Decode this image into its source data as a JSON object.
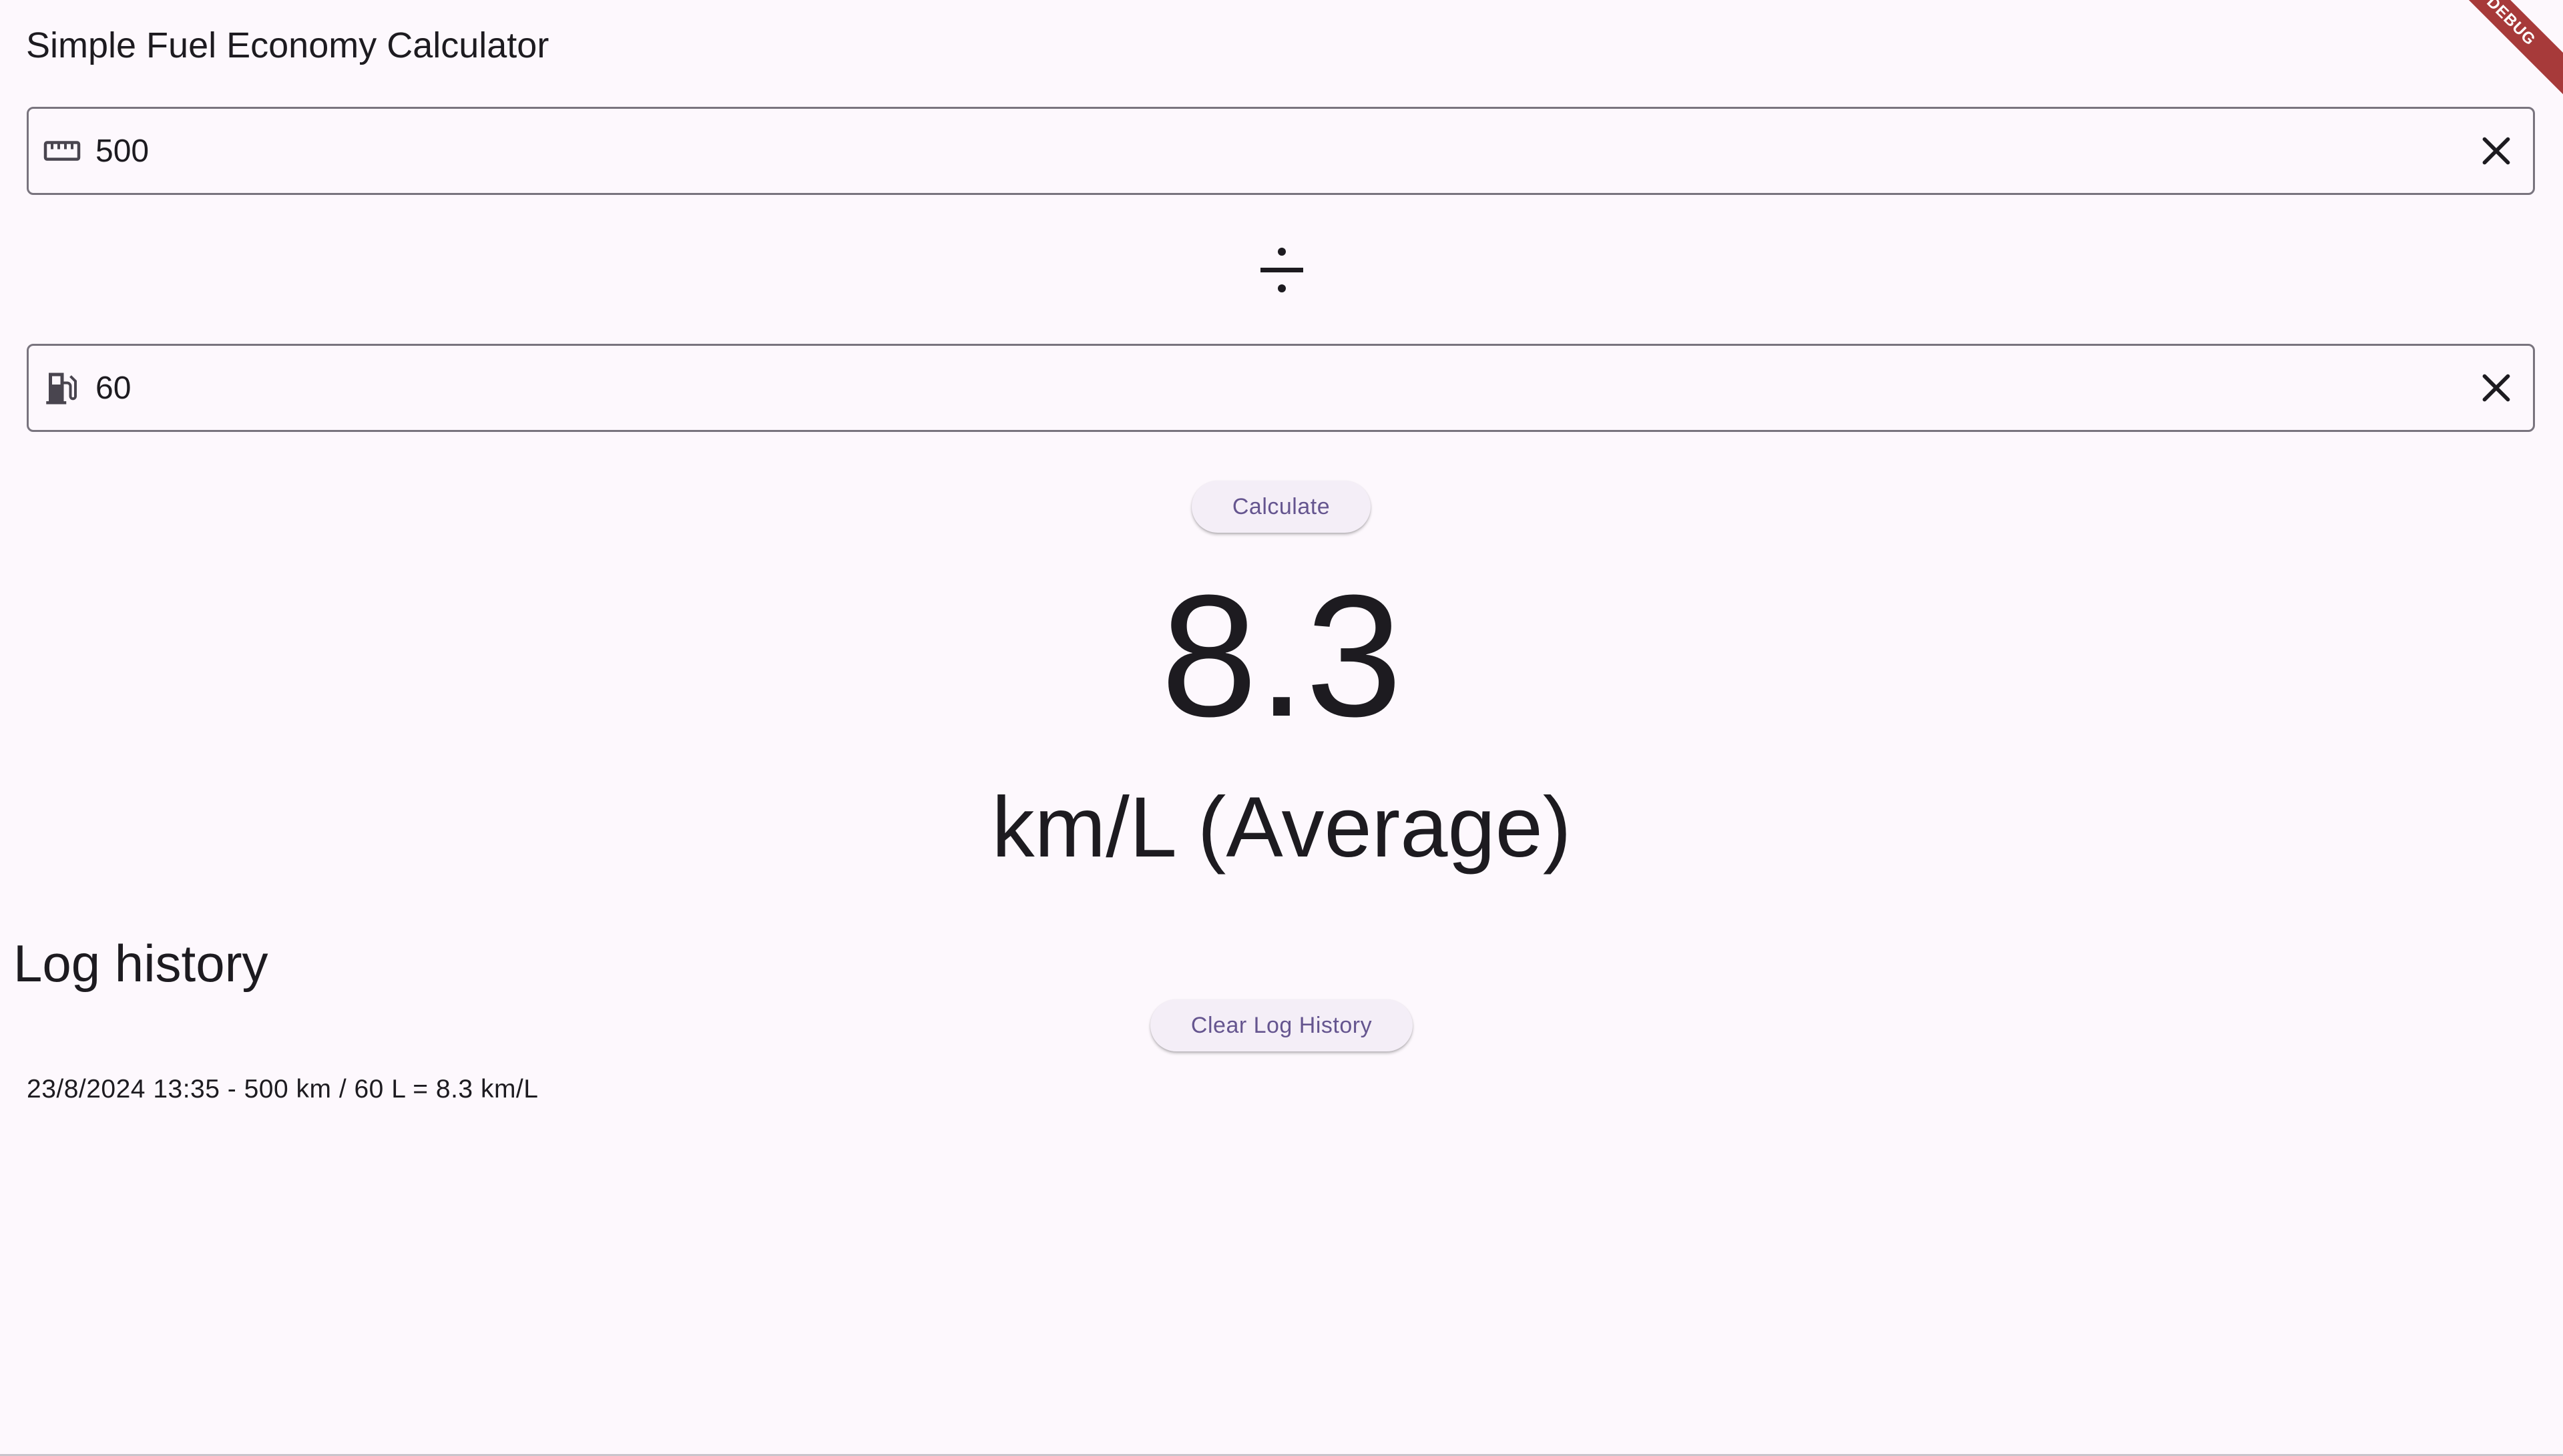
{
  "app": {
    "title": "Simple Fuel Economy Calculator",
    "debug_banner": "DEBUG"
  },
  "distance_field": {
    "icon": "straighten-ruler-icon",
    "value": "500",
    "clear_icon": "close-icon"
  },
  "operator": {
    "icon": "divide-icon"
  },
  "fuel_field": {
    "icon": "fuel-pump-icon",
    "value": "60",
    "clear_icon": "close-icon"
  },
  "calculate_button": {
    "label": "Calculate"
  },
  "result": {
    "value": "8.3",
    "unit": "km/L (Average)"
  },
  "log": {
    "heading": "Log history",
    "clear_button_label": "Clear Log History",
    "entries": [
      "23/8/2024 13:35 - 500 km / 60 L = 8.3 km/L"
    ]
  },
  "colors": {
    "background": "#fdf8fd",
    "button_background": "#f4eef7",
    "button_text": "#65558f",
    "field_border": "#79747e",
    "debug_banner": "#a73a3a"
  }
}
